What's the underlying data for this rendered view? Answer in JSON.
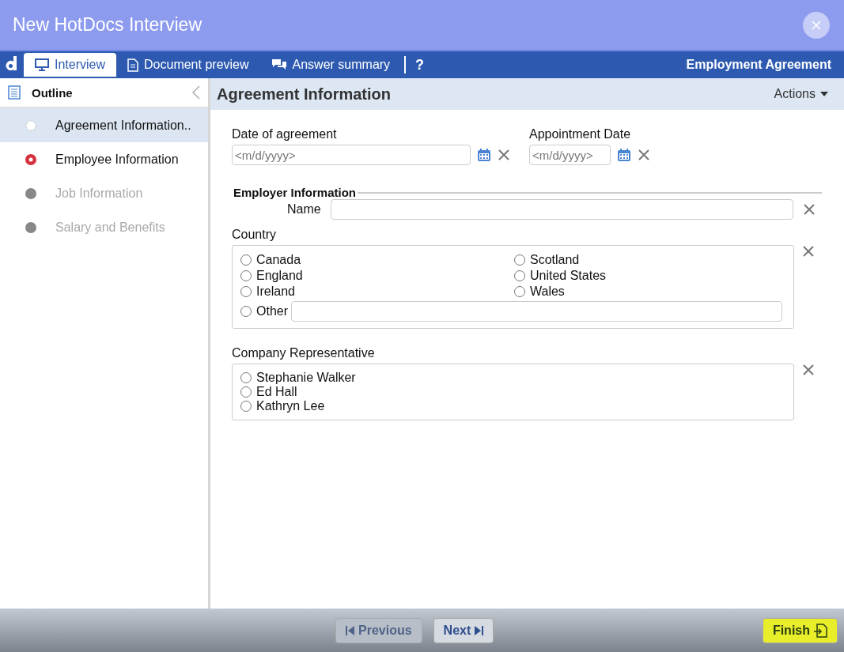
{
  "window": {
    "title": "New HotDocs Interview"
  },
  "tabs": [
    {
      "label": "Interview",
      "selected": true,
      "kind": "monitor"
    },
    {
      "label": "Document preview",
      "selected": false,
      "kind": "document"
    },
    {
      "label": "Answer summary",
      "selected": false,
      "kind": "chat"
    }
  ],
  "help": "?",
  "document_title": "Employment Agreement",
  "outline": {
    "title": "Outline",
    "items": [
      {
        "label": "Agreement Information..",
        "selected": true,
        "kind": "current",
        "disabled": false
      },
      {
        "label": "Employee Information",
        "selected": false,
        "kind": "error",
        "disabled": false
      },
      {
        "label": "Job Information",
        "selected": false,
        "kind": "pending",
        "disabled": true
      },
      {
        "label": "Salary and Benefits",
        "selected": false,
        "kind": "pending",
        "disabled": true
      }
    ]
  },
  "page": {
    "title": "Agreement Information",
    "actions": "Actions"
  },
  "dates": [
    {
      "label": "Date of agreement",
      "placeholder": "<m/d/yyyy>"
    },
    {
      "label": "Appointment Date",
      "placeholder": "<m/d/yyyy>"
    }
  ],
  "employer": {
    "title": "Employer Information",
    "name_label": "Name"
  },
  "country": {
    "label": "Country",
    "options": [
      {
        "label": "Canada",
        "selected": false
      },
      {
        "label": "England",
        "selected": false
      },
      {
        "label": "Ireland",
        "selected": false
      },
      {
        "label": "Scotland",
        "selected": false
      },
      {
        "label": "United States",
        "selected": false
      },
      {
        "label": "Wales",
        "selected": false
      }
    ],
    "other": {
      "label": "Other",
      "selected": false
    }
  },
  "representative": {
    "label": "Company Representative",
    "options": [
      {
        "label": "Stephanie Walker",
        "selected": false
      },
      {
        "label": "Ed Hall",
        "selected": false
      },
      {
        "label": "Kathryn Lee",
        "selected": false
      }
    ]
  },
  "footer": {
    "buttons": [
      {
        "label": "Previous",
        "kind": "previous",
        "disabled": true,
        "highlighted": false
      },
      {
        "label": "Next",
        "kind": "next",
        "disabled": false,
        "highlighted": false
      },
      {
        "label": "Finish",
        "kind": "finish",
        "disabled": false,
        "highlighted": true
      }
    ]
  }
}
